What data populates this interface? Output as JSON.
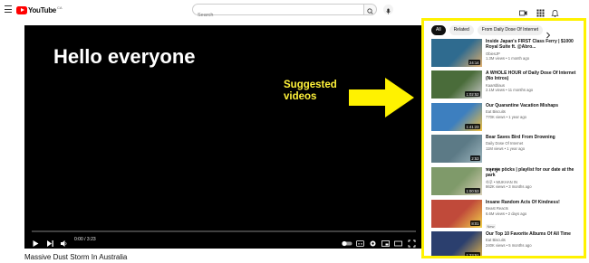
{
  "header": {
    "logo_text": "YouTube",
    "logo_country": "CA",
    "search_placeholder": "Search"
  },
  "player": {
    "overlay_text": "Hello everyone",
    "annotation_line1": "Suggested",
    "annotation_line2": "videos",
    "annotation_color": "#fff23a",
    "time_display": "0:00 / 3:23",
    "progress_fraction": 0.0
  },
  "video_title": "Massive Dust Storm In Australia",
  "sidebar": {
    "highlight_color": "#fff200",
    "chips": [
      "All",
      "Related",
      "From Daily Dose Of Internet"
    ],
    "recommendations": [
      {
        "title": "Inside Japan's FIRST Class Ferry | $1000 Royal Suite ft. @Abro...",
        "channel": "ObiesJP",
        "stats": "1.3M views • 1 month ago",
        "duration": "24:14",
        "thumb": "#2f6b8f",
        "thumb2": "#e0b070"
      },
      {
        "title": "A WHOLE HOUR of Daily Dose Of Internet (No Intros)",
        "channel": "Kaarsblaus",
        "stats": "2.1M views • 11 months ago",
        "duration": "1:02:52",
        "thumb": "#4a6c3a",
        "thumb2": "#c9c9c9"
      },
      {
        "title": "Our Quarantine Vacation Mishaps",
        "channel": "Eat Biscuits",
        "stats": "770K views • 1 year ago",
        "duration": "1:41:23",
        "thumb": "#3d7fbf",
        "thumb2": "#f0c040"
      },
      {
        "title": "Bear Saves Bird From Drowning",
        "channel": "Daily Dose Of Internet",
        "stats": "11M views • 1 year ago",
        "duration": "2:53",
        "thumb": "#5c7a86",
        "thumb2": "#9fb7bf"
      },
      {
        "title": "หลุดพูด pöcks | playlist for our date at the park",
        "channel": "하루 • MUKHAN IN",
        "stats": "862K views • 3 months ago",
        "duration": "1:00:53",
        "thumb": "#7f9a6a",
        "thumb2": "#d8d0b8"
      },
      {
        "title": "Insane Random Acts Of Kindness!",
        "channel": "Beast Reacts",
        "stats": "6.6M views • 2 days ago",
        "duration": "8:01",
        "new_badge": "New",
        "thumb": "#c04a3a",
        "thumb2": "#f2d24a"
      },
      {
        "title": "Our Top 10 Favorite Albums Of All Time",
        "channel": "Eat Biscuits",
        "stats": "240K views • 5 months ago",
        "duration": "1:33:51",
        "thumb": "#2b3f6e",
        "thumb2": "#e8b84a"
      }
    ]
  }
}
